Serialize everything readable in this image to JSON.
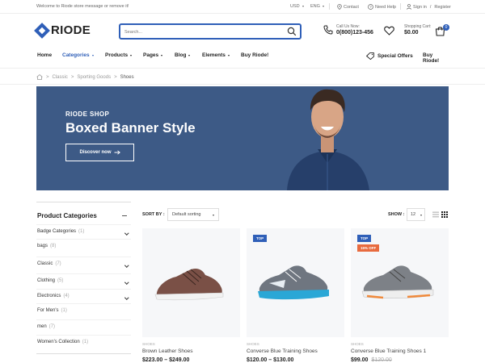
{
  "topbar": {
    "welcome": "Welcome to Riode store message or remove it!",
    "currency": "USD",
    "language": "ENG",
    "contact": "Contact",
    "help": "Need Help",
    "signin": "Sign in",
    "separator": "/",
    "register": "Register"
  },
  "header": {
    "logo": "RIODE",
    "search_placeholder": "Search...",
    "call_label": "Call Us Now:",
    "call_number": "0(800)123-456",
    "cart_label": "Shopping Cart:",
    "cart_amount": "$0.00",
    "cart_count": "0"
  },
  "nav": {
    "items": [
      "Home",
      "Categories",
      "Products",
      "Pages",
      "Blog",
      "Elements",
      "Buy Riode!"
    ],
    "special_offers": "Special Offers",
    "buy_right": "Buy Riode!"
  },
  "breadcrumb": {
    "items": [
      "Classic",
      "Sporting Goods",
      "Shoes"
    ],
    "sep": ">"
  },
  "banner": {
    "subtitle": "RIODE SHOP",
    "title": "Boxed Banner Style",
    "button": "Discover now"
  },
  "sidebar": {
    "title": "Product Categories",
    "categories": [
      {
        "name": "Badge Categories",
        "count": "(1)"
      },
      {
        "name": "bags",
        "count": "(8)"
      },
      {
        "name": "Classic",
        "count": "(7)"
      },
      {
        "name": "Clothing",
        "count": "(5)"
      },
      {
        "name": "Electronics",
        "count": "(4)"
      },
      {
        "name": "For Men's",
        "count": "(1)"
      },
      {
        "name": "men",
        "count": "(7)"
      },
      {
        "name": "Women's Collection",
        "count": "(1)"
      }
    ]
  },
  "toolbar": {
    "sort_label": "SORT BY :",
    "sort_value": "Default sorting",
    "show_label": "SHOW :",
    "show_value": "12"
  },
  "products": [
    {
      "category": "SHOES",
      "name": "Brown Leather Shoes",
      "price": "$223.00 – $249.00",
      "old_price": "",
      "badge_top": "",
      "badge_off": "",
      "color_body": "#7a5046",
      "color_sole": "#ffffff"
    },
    {
      "category": "SHOES",
      "name": "Converse Blue Training Shoes",
      "price": "$120.00 – $130.00",
      "old_price": "",
      "badge_top": "TOP",
      "badge_off": "",
      "color_body": "#6f7680",
      "color_sole": "#2aa7d6"
    },
    {
      "category": "SHOES",
      "name": "Converse Blue Training Shoes 1",
      "price": "$99.00",
      "old_price": "$120.00",
      "badge_top": "TOP",
      "badge_off": "15% OFF",
      "color_body": "#7d8187",
      "color_sole": "#f08a3c"
    }
  ],
  "colors": {
    "accent": "#2f5fb8",
    "banner_bg": "#3d5a86",
    "sale": "#e86b3f"
  }
}
